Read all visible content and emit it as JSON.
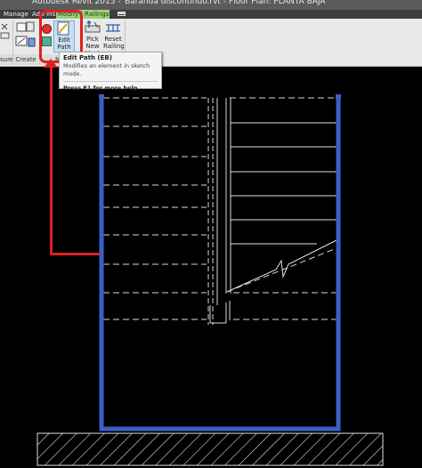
{
  "window": {
    "title_left": "Autodesk Revit 2015 -",
    "title_right": "Baranda discontinuo.rvt - Floor Plan: PLANTA BAJA"
  },
  "ribbon": {
    "tabs": [
      {
        "label": "Manage"
      },
      {
        "label": "Add-Ins"
      },
      {
        "label": "Modify | Railings"
      }
    ],
    "panels": {
      "measure": "sure",
      "create": "Create",
      "mode": "M"
    },
    "buttons": {
      "edit_path": "Edit Path",
      "pick_new_host": "Pick New Host",
      "reset_railing": "Reset Railing"
    }
  },
  "tooltip": {
    "title": "Edit Path (EB)",
    "description": "Modifies an element in sketch mode.",
    "help": "Press F1 for more help"
  },
  "colors": {
    "highlight": "#e02020",
    "railing_blue": "#3a5fc8",
    "canvas": "#000000"
  }
}
